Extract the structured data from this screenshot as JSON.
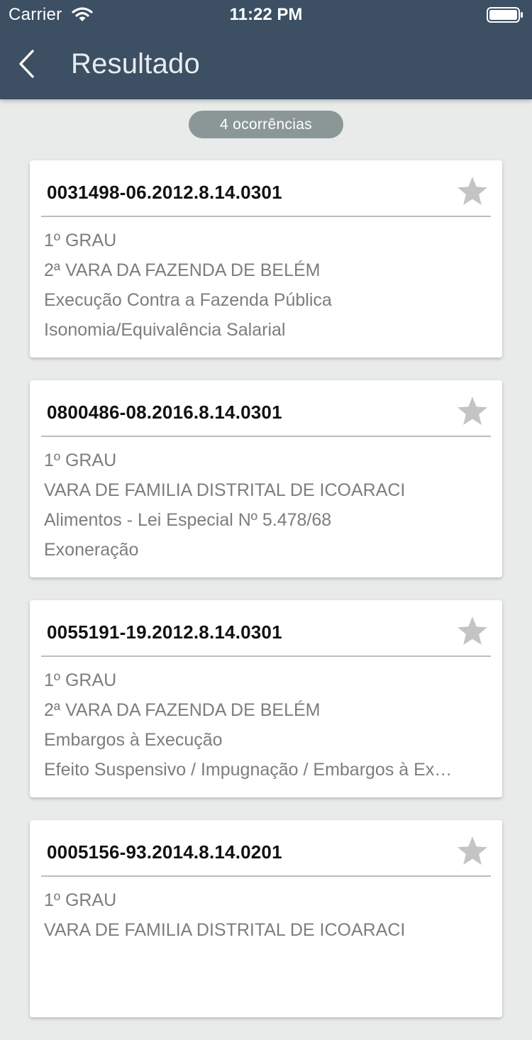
{
  "status_bar": {
    "carrier": "Carrier",
    "time": "11:22 PM"
  },
  "nav": {
    "title": "Resultado",
    "back_icon": "chevron-left-icon"
  },
  "result_count": "4 ocorrências",
  "colors": {
    "header_bg": "#3c4f63",
    "page_bg": "#e9ebeb",
    "badge_bg": "#8a9796",
    "star": "#c4c4c4"
  },
  "results": [
    {
      "number": "0031498-06.2012.8.14.0301",
      "lines": [
        "1º GRAU",
        "2ª VARA DA FAZENDA DE BELÉM",
        "Execução Contra a Fazenda Pública",
        "Isonomia/Equivalência Salarial"
      ]
    },
    {
      "number": "0800486-08.2016.8.14.0301",
      "lines": [
        "1º GRAU",
        "VARA DE FAMILIA DISTRITAL DE ICOARACI",
        "Alimentos - Lei Especial Nº 5.478/68",
        "Exoneração"
      ]
    },
    {
      "number": "0055191-19.2012.8.14.0301",
      "lines": [
        "1º GRAU",
        "2ª VARA DA FAZENDA DE BELÉM",
        "Embargos à Execução",
        "Efeito Suspensivo / Impugnação / Embargos à Ex…"
      ]
    },
    {
      "number": "0005156-93.2014.8.14.0201",
      "lines": [
        "1º GRAU",
        "VARA DE FAMILIA DISTRITAL DE ICOARACI",
        "",
        ""
      ]
    }
  ]
}
